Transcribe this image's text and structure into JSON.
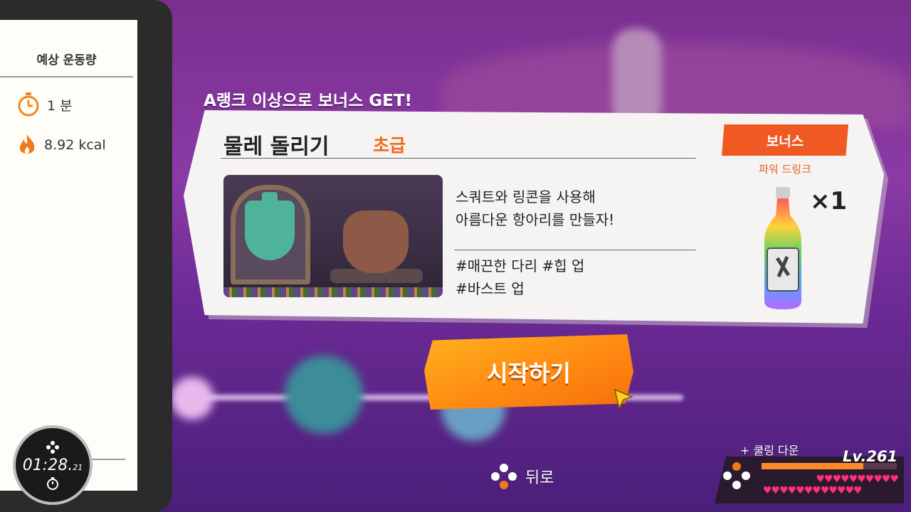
{
  "sidebar": {
    "title": "예상 운동량",
    "time_value": "1 분",
    "kcal_value": "8.92 kcal",
    "timer": {
      "main": "01:28.",
      "fraction": "21"
    }
  },
  "header": {
    "bonus_text": "A랭크 이상으로 보너스 GET!"
  },
  "course": {
    "title": "물레 돌리기",
    "difficulty": "초급",
    "description_line1": "스쿼트와 링콘을 사용해",
    "description_line2": "아름다운 항아리를 만들자!",
    "tags_line1": "#매끈한 다리 #힙 업",
    "tags_line2": "#바스트 업"
  },
  "bonus": {
    "badge": "보너스",
    "item_name": "파워 드링크",
    "multiplier": "×1"
  },
  "actions": {
    "start_label": "시작하기",
    "back_label": "뒤로"
  },
  "player": {
    "cooldown": "+ 쿨링 다운",
    "level": "Lv.261",
    "xp_fraction": 0.75,
    "hearts_row1": "♥♥♥♥♥♥♥♥♥♥",
    "hearts_row2": "♥♥♥♥♥♥♥♥♥♥♥♥"
  },
  "colors": {
    "accent_orange": "#f05a22",
    "difficulty_orange": "#f06a1a",
    "heart_pink": "#ff2f7a"
  }
}
